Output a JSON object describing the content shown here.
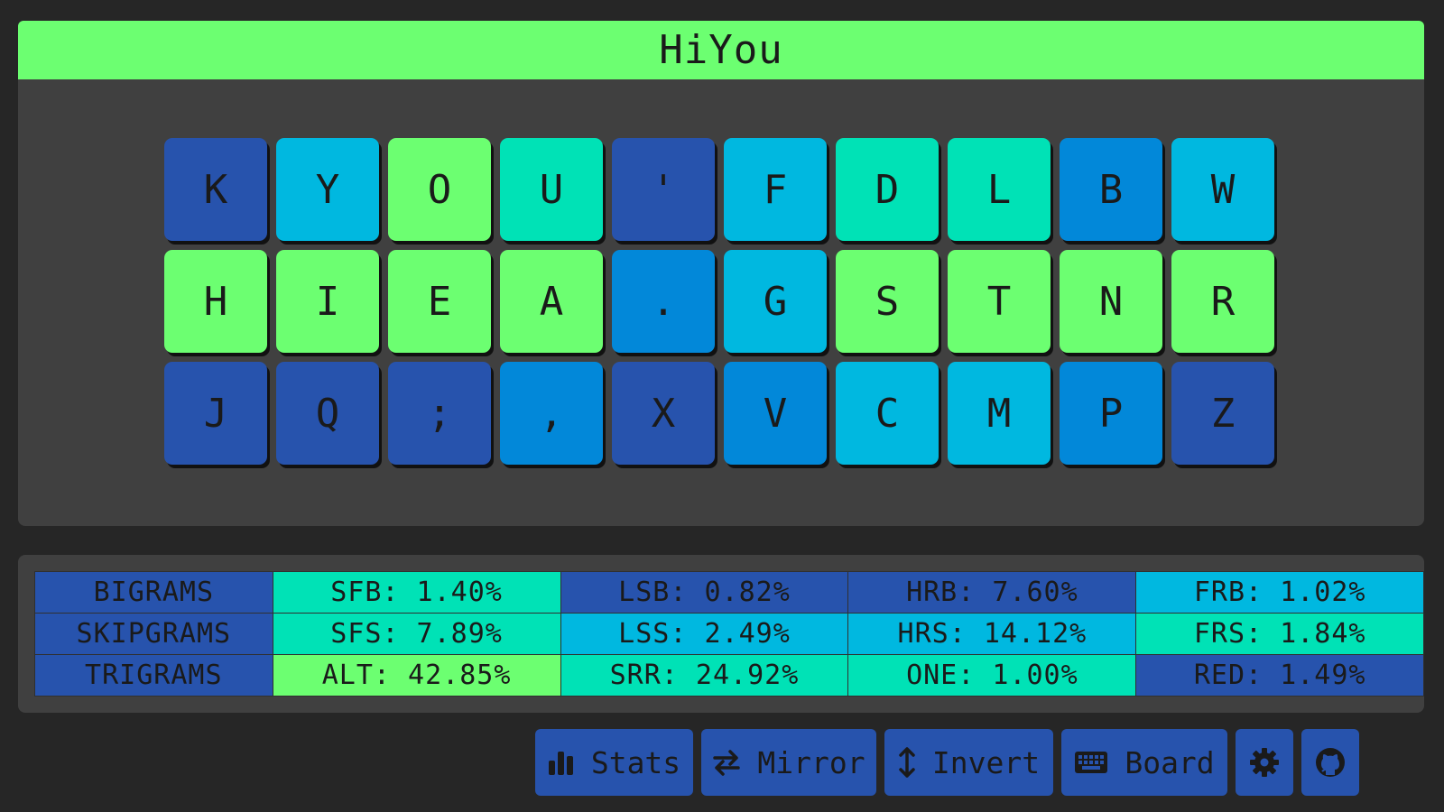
{
  "title": "HiYou",
  "colors": {
    "background": "#262626",
    "panel": "#404040",
    "title_bar": "#6cff71",
    "heat_darkblue": "#2753ad",
    "heat_blue": "#0288d9",
    "heat_cyan": "#00b8e0",
    "heat_teal": "#00e2b6",
    "heat_green": "#6cff71"
  },
  "keyboard": {
    "rows": [
      [
        {
          "char": "K",
          "color": "#2753ad"
        },
        {
          "char": "Y",
          "color": "#00b8e0"
        },
        {
          "char": "O",
          "color": "#6cff71"
        },
        {
          "char": "U",
          "color": "#00e2b6"
        },
        {
          "char": "'",
          "color": "#2753ad"
        },
        {
          "char": "F",
          "color": "#00b8e0"
        },
        {
          "char": "D",
          "color": "#00e2b6"
        },
        {
          "char": "L",
          "color": "#00e2b6"
        },
        {
          "char": "B",
          "color": "#0288d9"
        },
        {
          "char": "W",
          "color": "#00b8e0"
        }
      ],
      [
        {
          "char": "H",
          "color": "#6cff71"
        },
        {
          "char": "I",
          "color": "#6cff71"
        },
        {
          "char": "E",
          "color": "#6cff71"
        },
        {
          "char": "A",
          "color": "#6cff71"
        },
        {
          "char": ".",
          "color": "#0288d9"
        },
        {
          "char": "G",
          "color": "#00b8e0"
        },
        {
          "char": "S",
          "color": "#6cff71"
        },
        {
          "char": "T",
          "color": "#6cff71"
        },
        {
          "char": "N",
          "color": "#6cff71"
        },
        {
          "char": "R",
          "color": "#6cff71"
        }
      ],
      [
        {
          "char": "J",
          "color": "#2753ad"
        },
        {
          "char": "Q",
          "color": "#2753ad"
        },
        {
          "char": ";",
          "color": "#2753ad"
        },
        {
          "char": ",",
          "color": "#0288d9"
        },
        {
          "char": "X",
          "color": "#2753ad"
        },
        {
          "char": "V",
          "color": "#0288d9"
        },
        {
          "char": "C",
          "color": "#00b8e0"
        },
        {
          "char": "M",
          "color": "#00b8e0"
        },
        {
          "char": "P",
          "color": "#0288d9"
        },
        {
          "char": "Z",
          "color": "#2753ad"
        }
      ]
    ]
  },
  "stats": {
    "rows": [
      {
        "label": "BIGRAMS",
        "label_color": "#2753ad",
        "cells": [
          {
            "text": "SFB: 1.40%",
            "color": "#00e2b6"
          },
          {
            "text": "LSB: 0.82%",
            "color": "#2753ad"
          },
          {
            "text": "HRB: 7.60%",
            "color": "#2753ad"
          },
          {
            "text": "FRB: 1.02%",
            "color": "#00b8e0"
          }
        ]
      },
      {
        "label": "SKIPGRAMS",
        "label_color": "#2753ad",
        "cells": [
          {
            "text": "SFS: 7.89%",
            "color": "#00e2b6"
          },
          {
            "text": "LSS: 2.49%",
            "color": "#00b8e0"
          },
          {
            "text": "HRS: 14.12%",
            "color": "#00b8e0"
          },
          {
            "text": "FRS: 1.84%",
            "color": "#00e2b6"
          }
        ]
      },
      {
        "label": "TRIGRAMS",
        "label_color": "#2753ad",
        "cells": [
          {
            "text": "ALT: 42.85%",
            "color": "#6cff71"
          },
          {
            "text": "SRR: 24.92%",
            "color": "#00e2b6"
          },
          {
            "text": "ONE: 1.00%",
            "color": "#00e2b6"
          },
          {
            "text": "RED: 1.49%",
            "color": "#2753ad"
          }
        ]
      }
    ]
  },
  "toolbar": {
    "stats": {
      "label": "Stats",
      "icon": "bar-chart-icon"
    },
    "mirror": {
      "label": "Mirror",
      "icon": "swap-arrows-icon"
    },
    "invert": {
      "label": "Invert",
      "icon": "vertical-arrows-icon"
    },
    "board": {
      "label": "Board",
      "icon": "keyboard-icon"
    },
    "settings": {
      "icon": "gear-icon"
    },
    "github": {
      "icon": "github-icon"
    }
  }
}
